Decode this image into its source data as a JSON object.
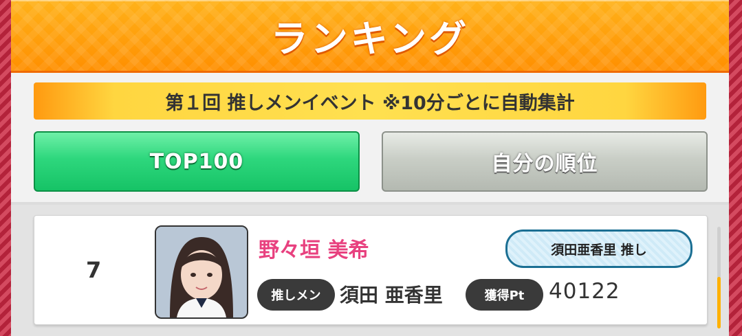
{
  "header": {
    "title": "ランキング"
  },
  "event_banner": {
    "text": "第１回 推しメンイベント ※10分ごとに自動集計"
  },
  "tabs": [
    {
      "label": "TOP100",
      "active": true
    },
    {
      "label": "自分の順位",
      "active": false
    }
  ],
  "ranking": [
    {
      "rank": "7",
      "name": "野々垣 美希",
      "oshi_badge": "須田亜香里 推し",
      "oshimen_label": "推しメン",
      "oshimen_value": "須田 亜香里",
      "points_label": "獲得Pt",
      "points_value": "40122"
    }
  ],
  "colors": {
    "header": "#ff9a00",
    "active_tab": "#2ed77d",
    "inactive_tab": "#c9cec6",
    "name": "#e8417f",
    "badge_border": "#1b6f93"
  }
}
